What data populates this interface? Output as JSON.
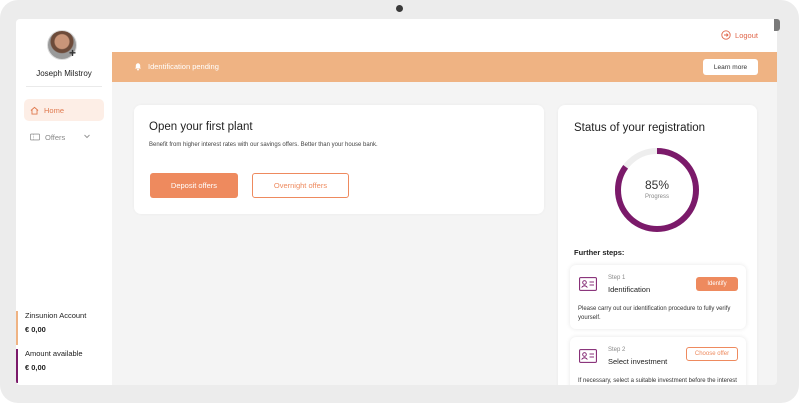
{
  "colors": {
    "accent": "#ee8a5e",
    "banner": "#efb383",
    "progress": "#7b1a6a",
    "logout": "#e0664a",
    "account_bar": "#efb383",
    "available_bar": "#7b1a6a"
  },
  "user": {
    "name": "Joseph Milstroy",
    "avatar_action_icon": "plus-icon"
  },
  "sidebar": {
    "items": [
      {
        "label": "Home",
        "icon": "home-icon",
        "active": true
      },
      {
        "label": "Offers",
        "icon": "ticket-icon",
        "expandable": true
      }
    ],
    "accounts": [
      {
        "label": "Zinsunion Account",
        "value": "€ 0,00"
      },
      {
        "label": "Amount available",
        "value": "€ 0,00"
      }
    ]
  },
  "header": {
    "logout_label": "Logout",
    "logout_icon": "logout-icon"
  },
  "banner": {
    "text": "Identification pending",
    "icon": "bell-icon",
    "button_label": "Learn more"
  },
  "plant_card": {
    "title": "Open your first plant",
    "description": "Benefit from higher interest rates with our savings offers. Better than your house bank.",
    "primary_button": "Deposit offers",
    "secondary_button": "Overnight offers"
  },
  "status_card": {
    "title": "Status of your registration",
    "progress_value": 85,
    "progress_text": "85%",
    "progress_label": "Progress",
    "further_steps_label": "Further steps:",
    "steps": [
      {
        "number": "Step 1",
        "name": "Identification",
        "icon": "id-card-icon",
        "button": "Identify",
        "description": "Please carry out our identification procedure to fully verify yourself."
      },
      {
        "number": "Step 2",
        "name": "Select investment",
        "icon": "id-card-icon",
        "button": "Choose offer",
        "description": "If necessary, select a suitable investment before the interest union account has been fully activated."
      }
    ]
  }
}
